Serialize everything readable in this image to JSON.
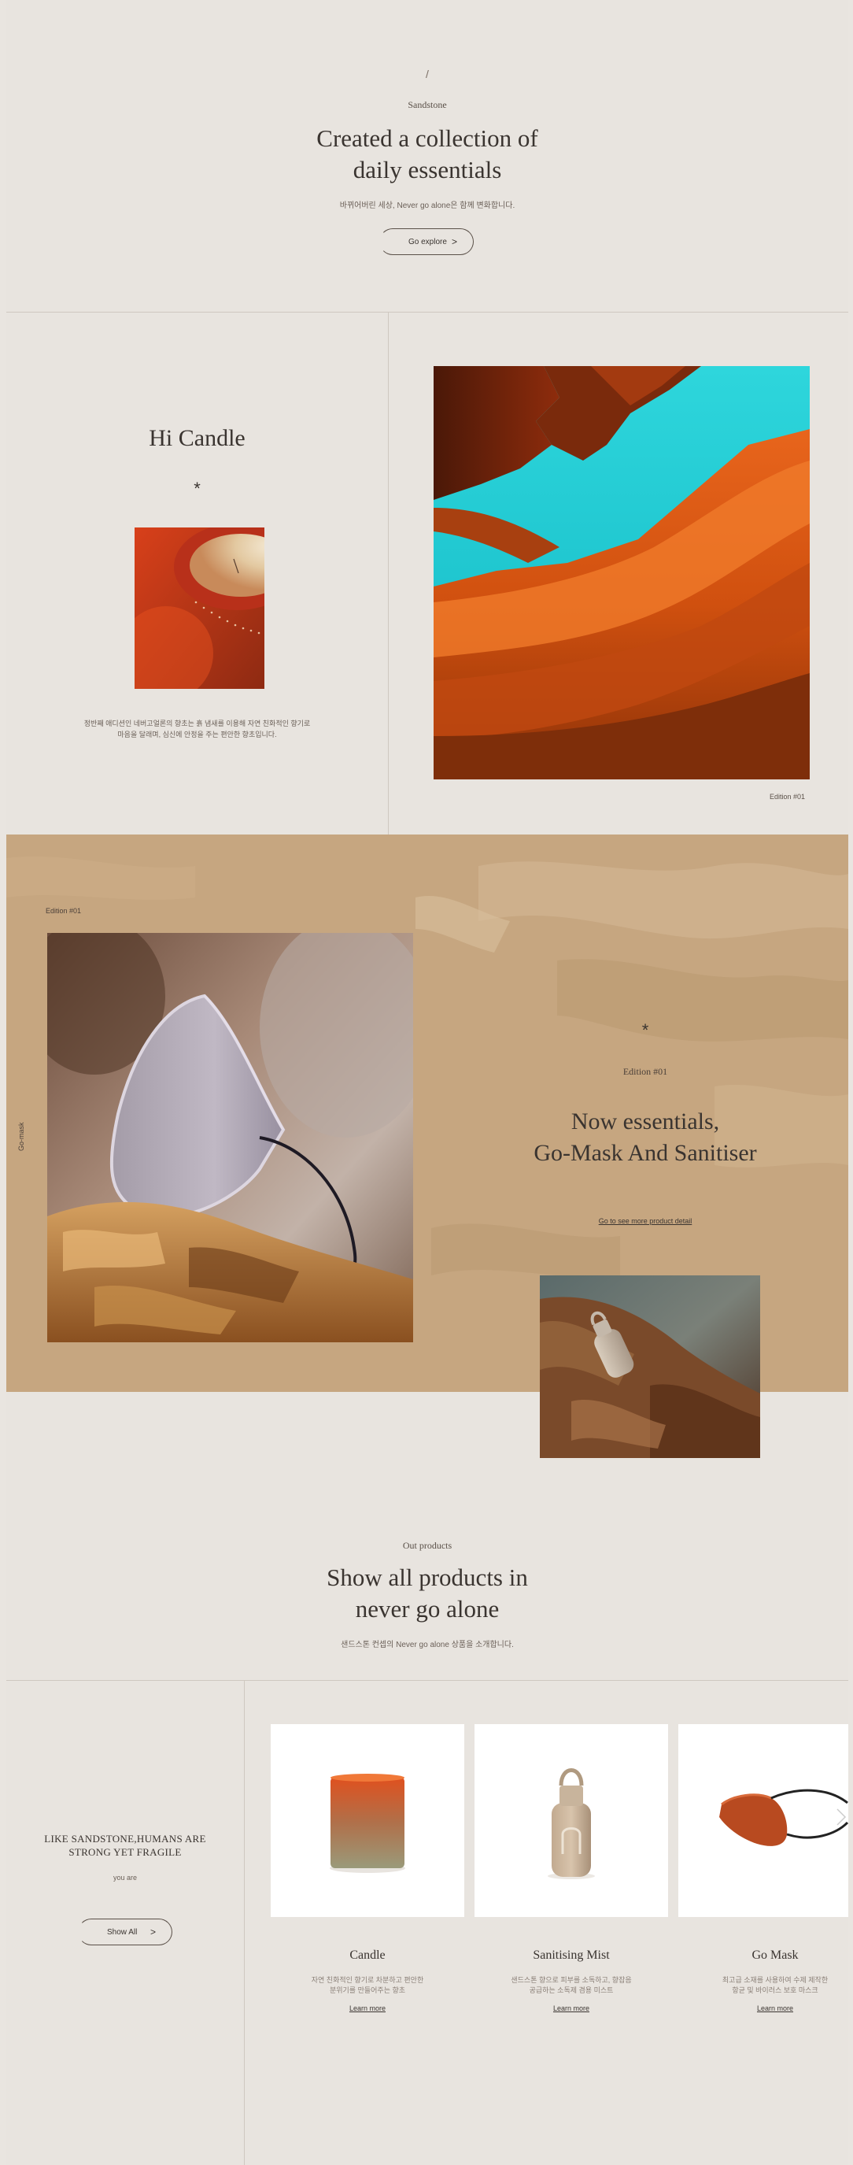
{
  "hero": {
    "slash": "/",
    "eyebrow": "Sandstone",
    "title_line1": "Created a collection of",
    "title_line2": "daily essentials",
    "subtitle": "바뀌어버린 세상, Never go alone은 함께 변화합니다.",
    "cta_label": "Go explore",
    "cta_arrow": ">"
  },
  "candle_section": {
    "title": "Hi Candle",
    "asterisk": "*",
    "desc_line1": "정반째 애디션인 네버고얼론의 향초는 흙 냄새를 이용해 자연 친화적인 향기로",
    "desc_line2": "마음을 달래며, 심신에 안정을 주는 편안한 향초입니다.",
    "edition_caption": "Edition #01"
  },
  "mask_section": {
    "edition_top": "Edition #01",
    "side_label": "Go-mask",
    "asterisk": "*",
    "edition_label": "Edition #01",
    "title_line1": "Now essentials,",
    "title_line2": "Go-Mask And Sanitiser",
    "link_label": "Go to see more product detail"
  },
  "products_intro": {
    "eyebrow": "Out products",
    "title_line1": "Show all products in",
    "title_line2": "never go alone",
    "subtitle": "샌드스톤 컨셉의 Never go alone 상품을 소개합니다."
  },
  "products_side": {
    "line1": "LIKE SANDSTONE,HUMANS ARE",
    "line2": "STRONG YET FRAGILE",
    "sub": "you are",
    "cta_label": "Show All",
    "cta_arrow": ">"
  },
  "products": [
    {
      "name": "Candle",
      "desc1": "자연 친화적인 향기로 차분하고 편안한",
      "desc2": "분위기를 만들어주는 향초",
      "link": "Learn more"
    },
    {
      "name": "Sanitising Mist",
      "desc1": "샌드스톤 향으로 피부를 소독하고, 향잡음",
      "desc2": "공급하는 소독제 겸용 미스트",
      "link": "Learn more"
    },
    {
      "name": "Go Mask",
      "desc1": "최고급 소재를 사용하여 수제 제작한",
      "desc2": "항균 및 바이러스 보호 마스크",
      "link": "Learn more"
    }
  ],
  "colors": {
    "background": "#e8e4df",
    "sand": "#c4a57f",
    "text": "#3a3430"
  }
}
